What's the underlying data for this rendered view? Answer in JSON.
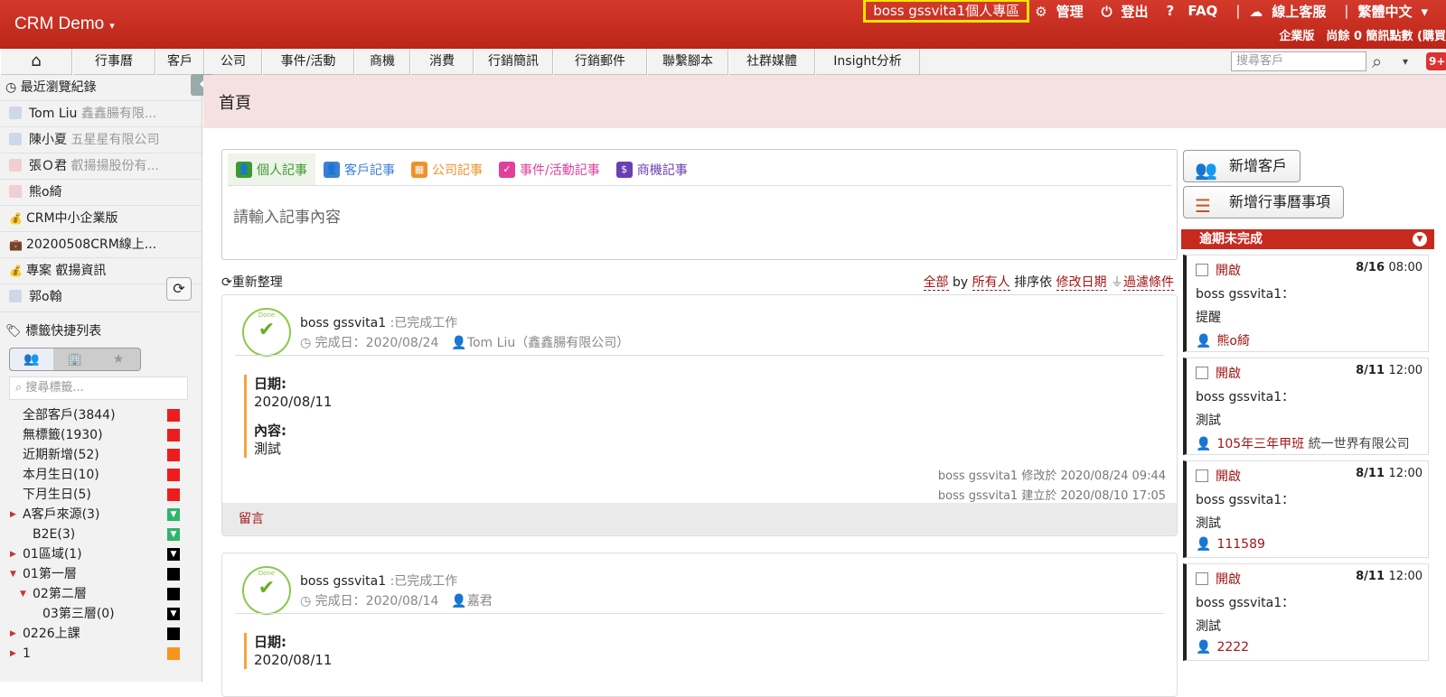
{
  "header": {
    "brand": "CRM Demo",
    "brand_caret": "▾",
    "personal_zone": "boss gssvita1個人專區",
    "links": {
      "manage": "管理",
      "logout": "登出",
      "faq": "FAQ",
      "support": "線上客服",
      "language": "繁體中文",
      "language_caret": "▾"
    },
    "icons": {
      "manage": "⚙",
      "logout": "⏻",
      "faq": "?",
      "support": "☁"
    },
    "sep": "|",
    "subinfo": "企業版　尚餘 0 簡訊點數 (購買"
  },
  "nav": {
    "home_icon": "⌂",
    "items": [
      "行事曆",
      "客戶",
      "公司",
      "事件/活動",
      "商機",
      "消費",
      "行銷簡訊",
      "行銷郵件",
      "聯繫腳本",
      "社群媒體",
      "Insight分析"
    ],
    "search_placeholder": "搜尋客戶",
    "search_icon": "⌕",
    "dropdown_icon": "▾",
    "badge": "9+"
  },
  "sidebar": {
    "collapse_icon": "⏴",
    "recent_title": "最近瀏覽紀錄",
    "recent_icon": "◷",
    "recent": [
      {
        "name": "Tom Liu",
        "sub": "鑫鑫腸有限...",
        "icon": "person"
      },
      {
        "name": "陳小夏",
        "sub": "五星星有限公司",
        "icon": "person"
      },
      {
        "name": "張Ｏ君",
        "sub": "叡揚揚股份有...",
        "icon": "person-pink"
      },
      {
        "name": "熊o綺",
        "sub": "",
        "icon": "person-pink"
      },
      {
        "name": "CRM中小企業版",
        "sub": "",
        "icon": "bag"
      },
      {
        "name": "20200508CRM線上...",
        "sub": "",
        "icon": "case"
      },
      {
        "name": "專案 叡揚資訊",
        "sub": "",
        "icon": "bag"
      },
      {
        "name": "郭o翰",
        "sub": "",
        "icon": "person"
      }
    ],
    "tag_title": "標籤快捷列表",
    "tag_icon": "🏷",
    "tag_tabs": [
      "👥",
      "🏢",
      "★"
    ],
    "refresh_icon": "⟳",
    "tag_search_placeholder": "搜尋標籤...",
    "tag_search_icon": "⌕",
    "tags": [
      {
        "label": "全部客戶(3844)",
        "indent": 0,
        "arrow": "",
        "color": "red",
        "mark": ""
      },
      {
        "label": "無標籤(1930)",
        "indent": 0,
        "arrow": "",
        "color": "red",
        "mark": ""
      },
      {
        "label": "近期新增(52)",
        "indent": 0,
        "arrow": "",
        "color": "red",
        "mark": ""
      },
      {
        "label": "本月生日(10)",
        "indent": 0,
        "arrow": "",
        "color": "red",
        "mark": ""
      },
      {
        "label": "下月生日(5)",
        "indent": 0,
        "arrow": "",
        "color": "red",
        "mark": ""
      },
      {
        "label": "A客戶來源(3)",
        "indent": 0,
        "arrow": "▶",
        "color": "green",
        "mark": "▼"
      },
      {
        "label": "B2E(3)",
        "indent": 1,
        "arrow": "",
        "color": "green",
        "mark": "▼"
      },
      {
        "label": "01區域(1)",
        "indent": 0,
        "arrow": "▶",
        "color": "black",
        "mark": "▼"
      },
      {
        "label": "01第一層",
        "indent": 0,
        "arrow": "▼",
        "color": "black",
        "mark": ""
      },
      {
        "label": "02第二層",
        "indent": 1,
        "arrow": "▼",
        "color": "black",
        "mark": ""
      },
      {
        "label": "03第三層(0)",
        "indent": 2,
        "arrow": "",
        "color": "black",
        "mark": "▼"
      },
      {
        "label": "0226上課",
        "indent": 0,
        "arrow": "▶",
        "color": "black",
        "mark": ""
      },
      {
        "label": "1",
        "indent": 0,
        "arrow": "▶",
        "color": "orange",
        "mark": ""
      }
    ]
  },
  "page": {
    "title": "首頁"
  },
  "composer": {
    "tabs": [
      {
        "label": "個人記事",
        "icon": "👤",
        "color": "#3c9a2e"
      },
      {
        "label": "客戶記事",
        "icon": "👤",
        "color": "#3a7fd5"
      },
      {
        "label": "公司記事",
        "icon": "▦",
        "color": "#f0912a"
      },
      {
        "label": "事件/活動記事",
        "icon": "✓",
        "color": "#e0409a"
      },
      {
        "label": "商機記事",
        "icon": "$",
        "color": "#6a3fb5"
      }
    ],
    "placeholder": "請輸入記事內容"
  },
  "list": {
    "refresh": "重新整理",
    "refresh_icon": "⟳",
    "filter_all": "全部",
    "by": "by",
    "filter_owner": "所有人",
    "sort_label": "排序依",
    "sort_field": "修改日期",
    "filter_icon": "⏚",
    "filter": "過濾條件"
  },
  "feed": [
    {
      "done_text": "Done",
      "author": "boss gssvita1",
      "status": ":已完成工作",
      "done_date": "完成日：2020/08/24",
      "person": "Tom Liu（鑫鑫腸有限公司）",
      "date_label": "日期:",
      "date_value": "2020/08/11",
      "content_label": "內容:",
      "content_value": "測試",
      "modified": "boss gssvita1 修改於 2020/08/24 09:44",
      "created": "boss gssvita1 建立於 2020/08/10 17:05",
      "comment": "留言"
    },
    {
      "done_text": "Done",
      "author": "boss gssvita1",
      "status": ":已完成工作",
      "done_date": "完成日：2020/08/14",
      "person": "嘉君",
      "date_label": "日期:",
      "date_value": "2020/08/11"
    }
  ],
  "right": {
    "add_customer": "新增客戶",
    "add_customer_icon": "👥",
    "add_event": "新增行事曆事項",
    "add_event_icon": "☰",
    "overdue_title": "逾期未完成",
    "overdue_toggle": "▼",
    "tasks": [
      {
        "status": "開啟",
        "date": "8/16",
        "time": "08:00",
        "owner": "boss gssvita1：",
        "subject": "提醒",
        "who": "熊o綺",
        "company": ""
      },
      {
        "status": "開啟",
        "date": "8/11",
        "time": "12:00",
        "owner": "boss gssvita1：",
        "subject": "測試",
        "who": "105年三年甲班",
        "company": "統一世界有限公司"
      },
      {
        "status": "開啟",
        "date": "8/11",
        "time": "12:00",
        "owner": "boss gssvita1：",
        "subject": "測試",
        "who": "111589",
        "company": ""
      },
      {
        "status": "開啟",
        "date": "8/11",
        "time": "12:00",
        "owner": "boss gssvita1：",
        "subject": "測試",
        "who": "2222",
        "company": ""
      }
    ]
  }
}
